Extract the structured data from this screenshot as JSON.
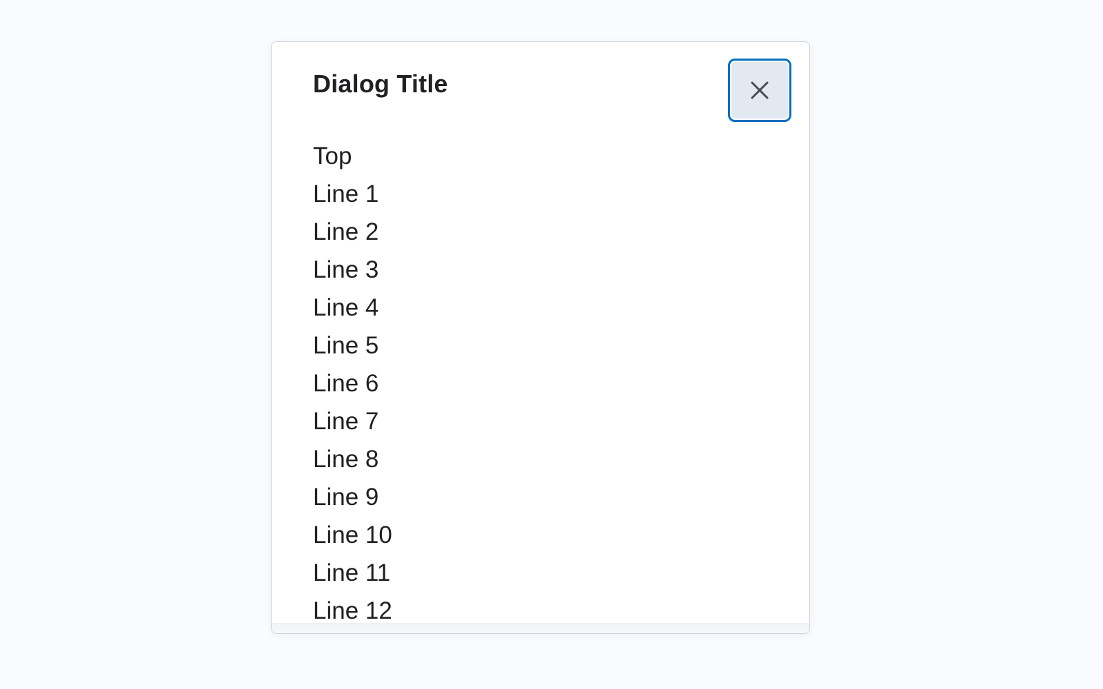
{
  "dialog": {
    "title": "Dialog Title",
    "close_icon": "close-icon",
    "close_aria_label": "Close",
    "lines": [
      "Top",
      "Line 1",
      "Line 2",
      "Line 3",
      "Line 4",
      "Line 5",
      "Line 6",
      "Line 7",
      "Line 8",
      "Line 9",
      "Line 10",
      "Line 11",
      "Line 12"
    ]
  },
  "colors": {
    "background": "#f9fbff",
    "focus_ring": "#006fbf",
    "close_button_bg": "#e3e9f1",
    "text": "#202122"
  }
}
